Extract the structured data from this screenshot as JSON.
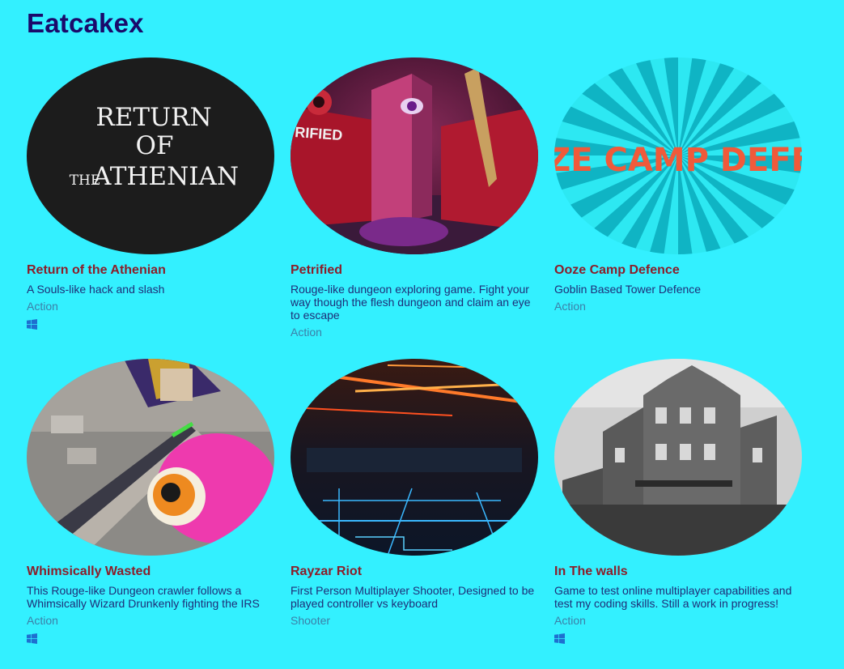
{
  "site": {
    "title": "Eatcakex"
  },
  "colors": {
    "background": "#33f0ff",
    "site_title": "#1a0a6b",
    "game_title": "#8b1e2a",
    "description": "#1e2e78",
    "genre": "#3b7fa8"
  },
  "games": [
    {
      "title": "Return of the Athenian",
      "description": "A Souls-like hack and slash",
      "genre": "Action",
      "platform": "windows-icon",
      "thumb_lines": [
        "RETURN",
        "OF",
        "THE",
        "ATHENIAN"
      ]
    },
    {
      "title": "Petrified",
      "description": "Rouge-like dungeon exploring game. Fight your way though the flesh dungeon and claim an eye to escape",
      "genre": "Action",
      "platform": null,
      "thumb_text": "RIFIED"
    },
    {
      "title": "Ooze Camp Defence",
      "description": "Goblin Based Tower Defence",
      "genre": "Action",
      "platform": null,
      "thumb_text": "OOZE CAMP DEFENC"
    },
    {
      "title": "Whimsically Wasted",
      "description": "This Rouge-like Dungeon crawler follows a Whimsically Wizard Drunkenly fighting the IRS",
      "genre": "Action",
      "platform": "windows-icon"
    },
    {
      "title": "Rayzar Riot",
      "description": "First Person Multiplayer Shooter, Designed to be played controller vs keyboard",
      "genre": "Shooter",
      "platform": null
    },
    {
      "title": "In The walls",
      "description": "Game to test online multiplayer capabilities and test my coding skills. Still a work in progress!",
      "genre": "Action",
      "platform": "windows-icon"
    }
  ]
}
